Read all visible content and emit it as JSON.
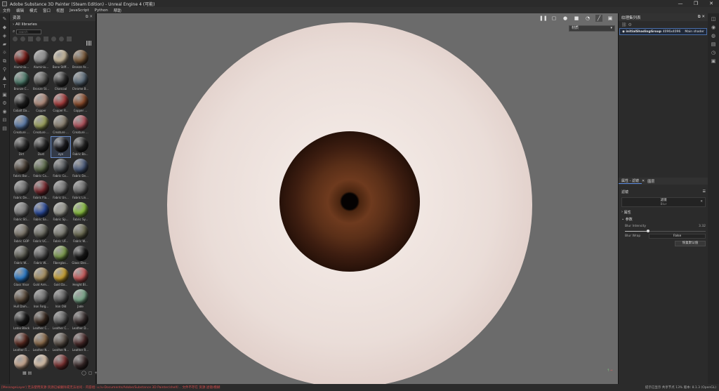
{
  "window": {
    "title": "Adobe Substance 3D Painter (Steam Edition) - Unreal Engine 4 (可能)",
    "controls": [
      "—",
      "❐",
      "✕"
    ]
  },
  "menu": [
    "文件",
    "编辑",
    "模式",
    "窗口",
    "视图",
    "JavaScript",
    "Python",
    "帮助"
  ],
  "shelf": {
    "title": "资源",
    "library_path": "All libraries",
    "search_placeholder": "search",
    "materials": [
      {
        "name": "Aluminiu...",
        "color": "#7a1f1a"
      },
      {
        "name": "Aluminiu...",
        "color": "#8d8d8d"
      },
      {
        "name": "Bone Stiff...",
        "color": "#c8b89a"
      },
      {
        "name": "Bronze Ar...",
        "color": "#7a5a3a"
      },
      {
        "name": "Bronze C...",
        "color": "#4c7a6a"
      },
      {
        "name": "Bronze St...",
        "color": "#5a5a58"
      },
      {
        "name": "Charcoal",
        "color": "#303030"
      },
      {
        "name": "Chrome B...",
        "color": "#5a6a78"
      },
      {
        "name": "Cobalt Da...",
        "color": "#202020"
      },
      {
        "name": "Copper",
        "color": "#b08a7a"
      },
      {
        "name": "Copper R...",
        "color": "#a63a3a"
      },
      {
        "name": "Copper ...",
        "color": "#8a4a2a"
      },
      {
        "name": "Creature ...",
        "color": "#5a7aa8"
      },
      {
        "name": "Creature ...",
        "color": "#9aa05a"
      },
      {
        "name": "Creature ...",
        "color": "#8a8070"
      },
      {
        "name": "Creature ...",
        "color": "#b0505a"
      },
      {
        "name": "Dirt",
        "color": "#303030"
      },
      {
        "name": "Dust",
        "color": "#2a2a2a"
      },
      {
        "name": "eye",
        "color": "#1e1e22"
      },
      {
        "name": "Fabric Ba...",
        "color": "#262626"
      },
      {
        "name": "Fabric Bor...",
        "color": "#4a4036"
      },
      {
        "name": "Fabric Ca...",
        "color": "#5c6a4a"
      },
      {
        "name": "Fabric Co...",
        "color": "#505458"
      },
      {
        "name": "Fabric De...",
        "color": "#4a5a7a"
      },
      {
        "name": "Fabric De...",
        "color": "#6a6a6a"
      },
      {
        "name": "Fabric Fla...",
        "color": "#7a2a30"
      },
      {
        "name": "Fabric Un...",
        "color": "#707070"
      },
      {
        "name": "Fabric Lin...",
        "color": "#686868"
      },
      {
        "name": "Fabric Sti...",
        "color": "#7a7a7a"
      },
      {
        "name": "Fabric Sa...",
        "color": "#2a4a9a"
      },
      {
        "name": "Fabric Sp...",
        "color": "#9a9a90"
      },
      {
        "name": "Fabric Sy...",
        "color": "#8ac040"
      },
      {
        "name": "Fabric GOP",
        "color": "#7a7468"
      },
      {
        "name": "Fabric UC...",
        "color": "#6a6a60"
      },
      {
        "name": "Fabric UF...",
        "color": "#7a7a70"
      },
      {
        "name": "Fabric W...",
        "color": "#6a6a50"
      },
      {
        "name": "Fabric W...",
        "color": "#5a5a50"
      },
      {
        "name": "Fabric W...",
        "color": "#585858"
      },
      {
        "name": "Fiberglas...",
        "color": "#7a9a4a"
      },
      {
        "name": "Glass Elec...",
        "color": "#1a1a1a"
      },
      {
        "name": "Glass Visor",
        "color": "#2a7ac8"
      },
      {
        "name": "Gold Arm...",
        "color": "#a89060"
      },
      {
        "name": "Gold Da...",
        "color": "#c8a030"
      },
      {
        "name": "Height Bl...",
        "color": "#c85a5a"
      },
      {
        "name": "Hull Dam...",
        "color": "#5a4a3a"
      },
      {
        "name": "Iron Forg...",
        "color": "#6a6a6a"
      },
      {
        "name": "Iron Old",
        "color": "#5a5a5a"
      },
      {
        "name": "Jade",
        "color": "#7aa88a"
      },
      {
        "name": "Latex Black",
        "color": "#1a1a1a"
      },
      {
        "name": "Leather C...",
        "color": "#3a2a20"
      },
      {
        "name": "Leather C...",
        "color": "#5a5a5a"
      },
      {
        "name": "Leather D...",
        "color": "#3a3030"
      },
      {
        "name": "Leather Fi...",
        "color": "#5a2a20"
      },
      {
        "name": "Leather N...",
        "color": "#8a6a4a"
      },
      {
        "name": "Leather N...",
        "color": "#5a5048"
      },
      {
        "name": "Leather R...",
        "color": "#4a2a2a"
      },
      {
        "name": "",
        "color": "#c8a890"
      },
      {
        "name": "",
        "color": "#d8c0a8"
      },
      {
        "name": "",
        "color": "#7a3030"
      },
      {
        "name": "",
        "color": "#3a2a2a"
      }
    ]
  },
  "viewport": {
    "view_mode": "材质"
  },
  "texture_set": {
    "panel_title": "纹理集列表",
    "items": [
      {
        "name": "initialShadingGroup",
        "size": "4096x4096",
        "shader": "Main shader"
      }
    ]
  },
  "properties": {
    "tabs": [
      "属性 - 滤镜",
      "图层"
    ],
    "header": "滤镜",
    "filter_name": "滤镜",
    "filter_sub": "Blur",
    "section_attributes": "属性",
    "section_params": "参数",
    "blur_intensity_label": "Blur Intensity",
    "blur_intensity_value": "3.32",
    "blur_intensity_fraction": 0.29,
    "blur_wrap_label": "Blur Wrap",
    "blur_wrap_value": "False",
    "reset_button": "恢复默认值"
  },
  "statusbar": {
    "error_text": "[MessageLayer] 无法使用资源:资源已被删除或无法访问 - 内容组: u:/u-Documents/Adobe/Substance 3D Painter/shelf/... 文件不存在 资源:滤镜/模糊",
    "right_text": "提示已显示 共享节点   13%   版本: 8.1.3 (OpenGL)"
  },
  "colors": {
    "accent": "#5a8ae0",
    "error": "#d44b4b",
    "viewport_bg": "#6b6b6b"
  }
}
